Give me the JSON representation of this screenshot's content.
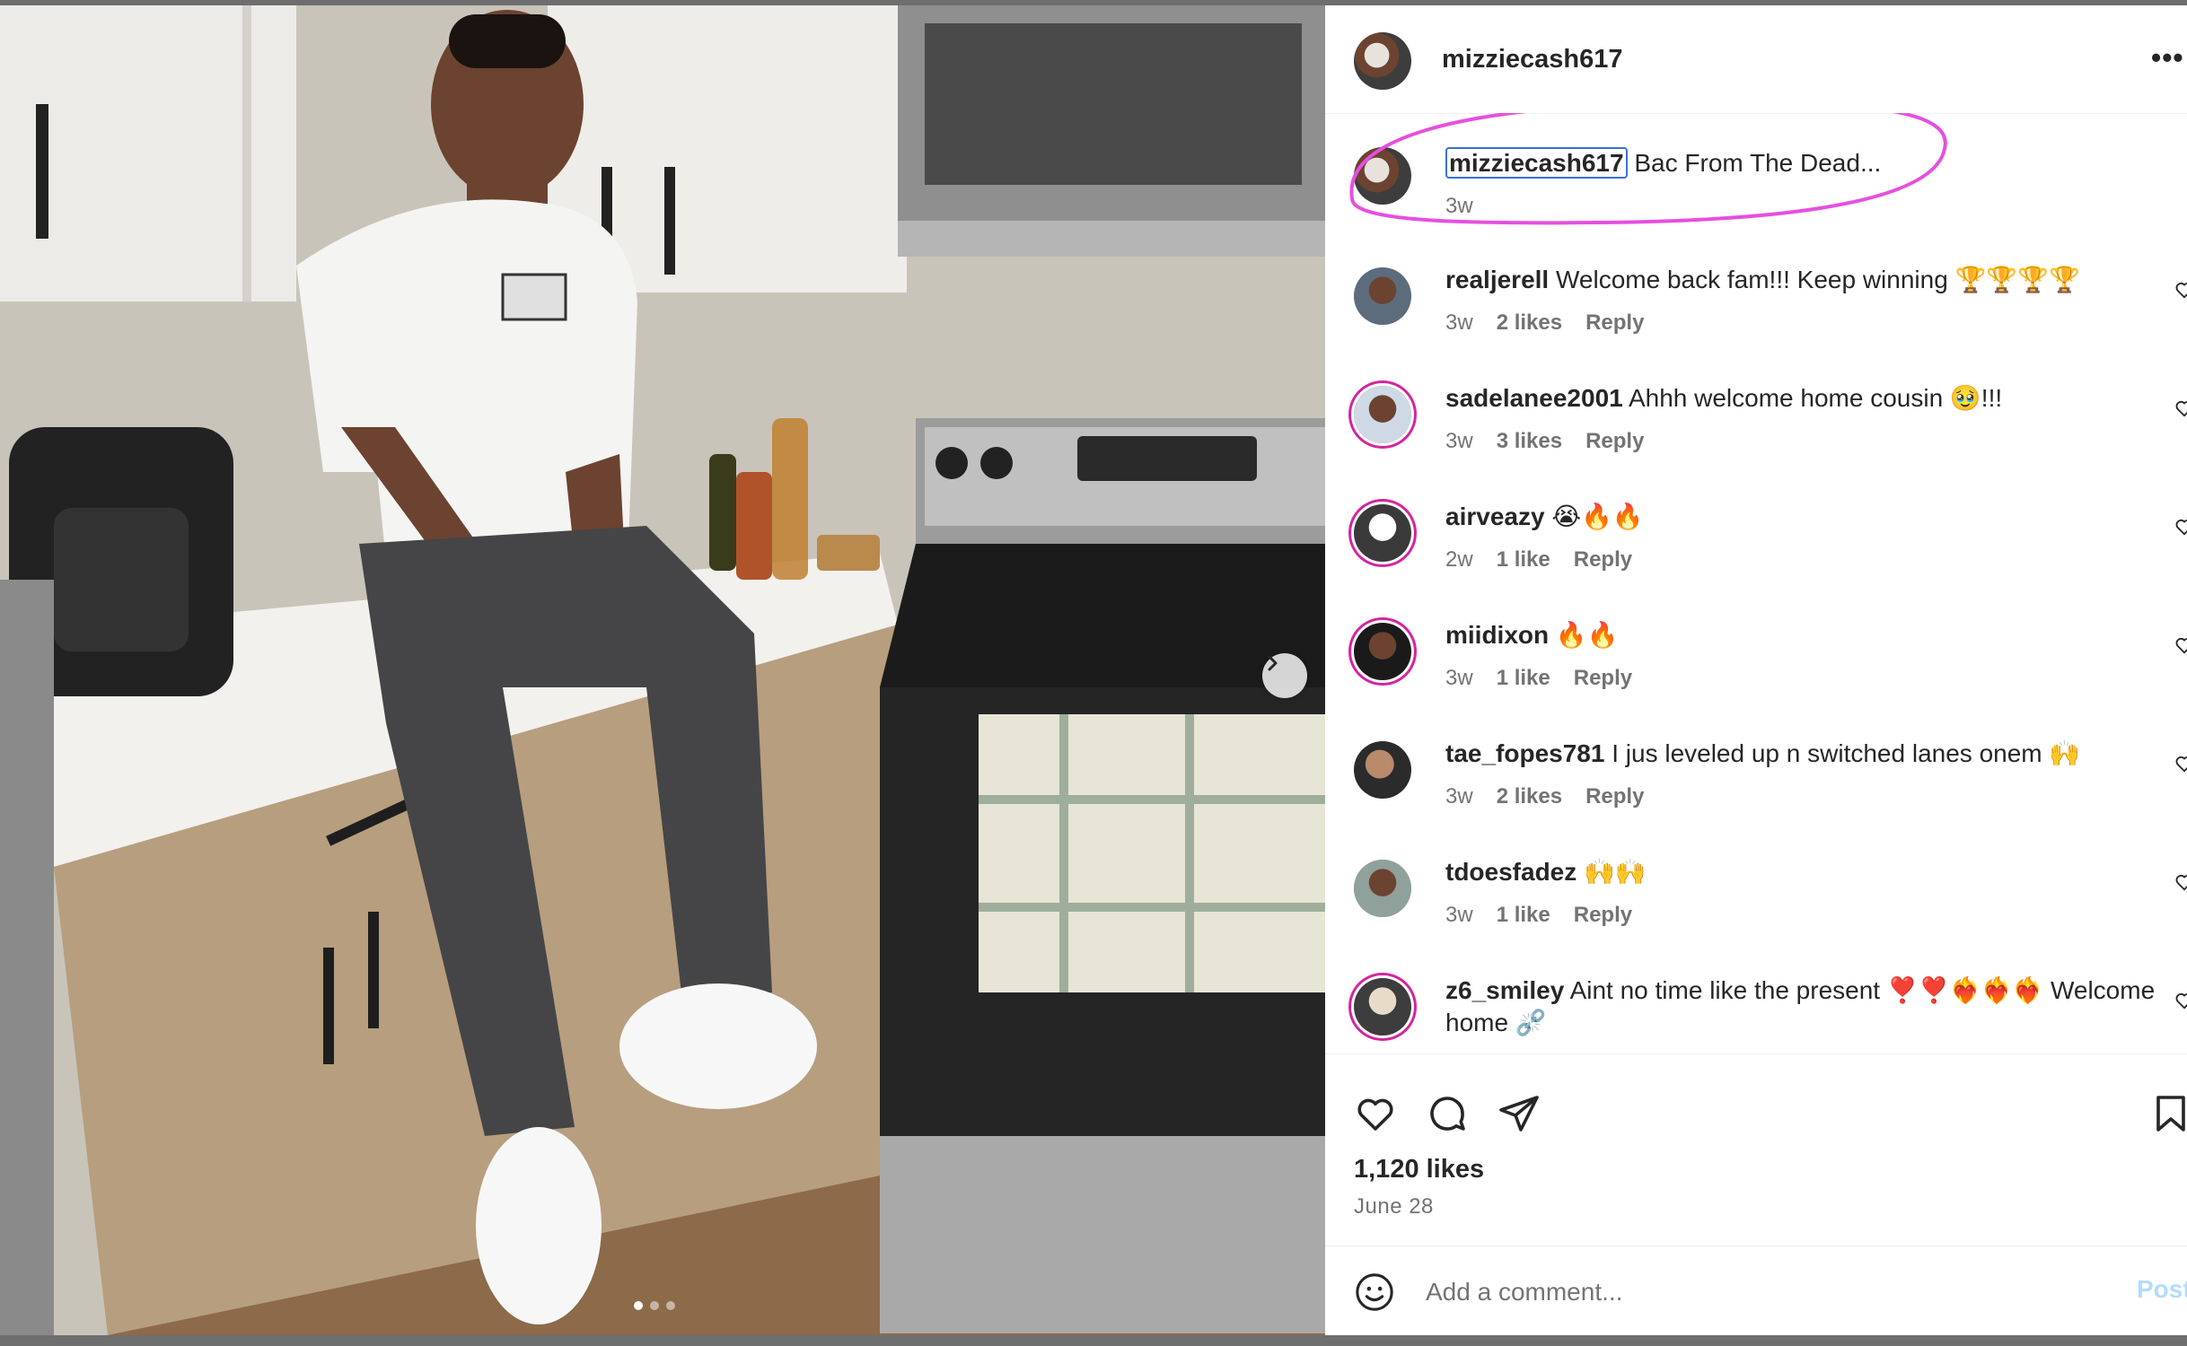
{
  "post": {
    "username": "mizziecash617",
    "more_label": "•••",
    "caption": {
      "username": "mizziecash617",
      "text": "Bac From The Dead...",
      "time": "3w"
    },
    "comments": [
      {
        "username": "realjerell",
        "text": "Welcome back fam!!! Keep winning 🏆🏆🏆🏆",
        "time": "3w",
        "likes": "2 likes",
        "reply": "Reply"
      },
      {
        "username": "sadelanee2001",
        "text": "Ahhh welcome home cousin 🥹!!!",
        "time": "3w",
        "likes": "3 likes",
        "reply": "Reply"
      },
      {
        "username": "airveazy",
        "text": "😭🔥🔥",
        "time": "2w",
        "likes": "1 like",
        "reply": "Reply"
      },
      {
        "username": "miidixon",
        "text": "🔥🔥",
        "time": "3w",
        "likes": "1 like",
        "reply": "Reply"
      },
      {
        "username": "tae_fopes781",
        "text": "I jus leveled up n switched lanes onem 🙌",
        "time": "3w",
        "likes": "2 likes",
        "reply": "Reply"
      },
      {
        "username": "tdoesfadez",
        "text": "🙌🙌",
        "time": "3w",
        "likes": "1 like",
        "reply": "Reply"
      },
      {
        "username": "z6_smiley",
        "text": "Aint no time like the present ❣️❣️❤️‍🔥❤️‍🔥❤️‍🔥 Welcome home ⛓️‍💥",
        "time": "",
        "likes": "",
        "reply": ""
      }
    ],
    "likes_count": "1,120 likes",
    "date": "June 28",
    "add_comment_placeholder": "Add a comment...",
    "post_button": "Post"
  },
  "carousel": {
    "current": 1,
    "total": 3
  },
  "icons": {
    "like": "heart-icon",
    "comment": "comment-icon",
    "share": "share-icon",
    "save": "bookmark-icon",
    "emoji": "emoji-icon",
    "next": "chevron-right-icon",
    "more": "more-icon"
  },
  "colors": {
    "highlight_oval": "#e64fe0",
    "mention_box": "#3b6fd8",
    "story_ring": "#d6249f",
    "muted_text": "#737373",
    "post_button": "#b3dbff"
  }
}
